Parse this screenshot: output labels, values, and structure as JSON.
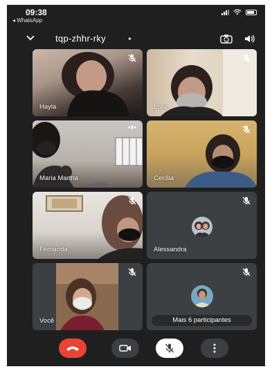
{
  "status_bar": {
    "time": "09:38",
    "back_app": "◂ WhatsApp"
  },
  "meeting": {
    "code": "tqp-zhhr-rky",
    "code_arrow": "▸"
  },
  "participants": [
    {
      "name": "Hayla",
      "muted": true
    },
    {
      "name": "Lívia",
      "muted": true
    },
    {
      "name": "Maria Martha",
      "muted": false
    },
    {
      "name": "Cecília",
      "muted": true
    },
    {
      "name": "Fernanda",
      "muted": true
    },
    {
      "name": "Alessandra",
      "muted": true
    },
    {
      "name": "Você",
      "muted": true
    }
  ],
  "more_participants_label": "Mais 6 participantes",
  "colors": {
    "end_call": "#ea4335",
    "tile_bg": "#3c4043",
    "screen_bg": "#1f1f1f"
  }
}
